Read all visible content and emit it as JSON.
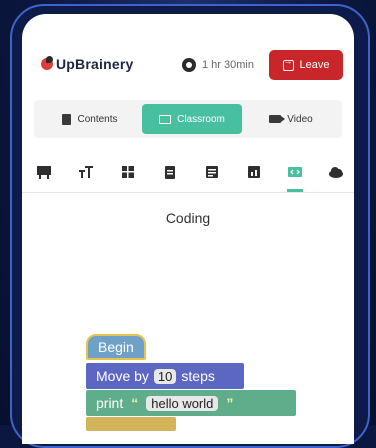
{
  "header": {
    "logo_text": "UpBrainery",
    "timer": "1 hr 30min",
    "leave_label": "Leave"
  },
  "tabs": [
    {
      "label": "Contents",
      "active": false
    },
    {
      "label": "Classroom",
      "active": true
    },
    {
      "label": "Video",
      "active": false
    }
  ],
  "toolbar": {
    "icons": [
      "board-icon",
      "text-size-icon",
      "grid-icon",
      "clipboard-icon",
      "list-icon",
      "chart-icon",
      "code-icon",
      "cloud-icon"
    ],
    "active_icon": "code-icon"
  },
  "main": {
    "title": "Coding"
  },
  "blocks": {
    "begin": "Begin",
    "move_prefix": "Move by",
    "move_value": "10",
    "move_suffix": "steps",
    "print_label": "print",
    "open_quote": "“",
    "print_value": "hello world",
    "close_quote": "”"
  },
  "colors": {
    "accent": "#48c0a0",
    "leave": "#c8262a",
    "background": "#0b1740",
    "block_begin": "#6fa0c7",
    "block_move": "#5b67c2",
    "block_print": "#5fad8a"
  }
}
